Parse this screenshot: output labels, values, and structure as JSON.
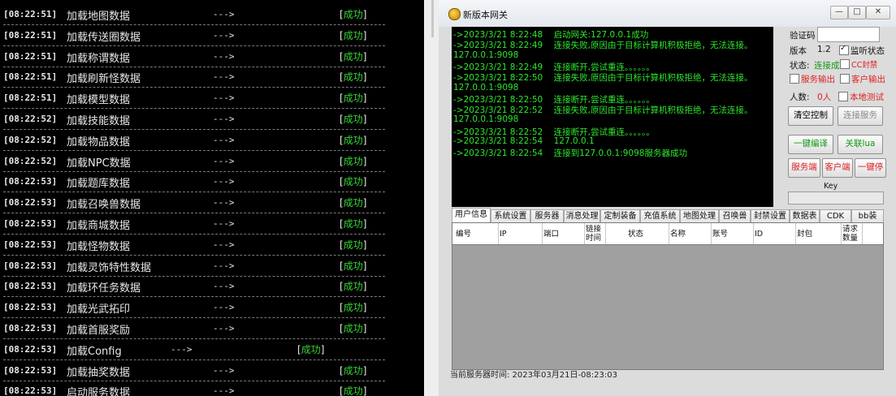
{
  "console": {
    "arrow": "--->",
    "bracket_open": "[",
    "bracket_close": "]",
    "rows": [
      {
        "time": "[08:22:51]",
        "msg": "加载地图数据",
        "status": "成功"
      },
      {
        "time": "[08:22:51]",
        "msg": "加载传送圈数据",
        "status": "成功"
      },
      {
        "time": "[08:22:51]",
        "msg": "加载称谓数据",
        "status": "成功"
      },
      {
        "time": "[08:22:51]",
        "msg": "加载刷新怪数据",
        "status": "成功"
      },
      {
        "time": "[08:22:51]",
        "msg": "加载模型数据",
        "status": "成功"
      },
      {
        "time": "[08:22:52]",
        "msg": "加载技能数据",
        "status": "成功"
      },
      {
        "time": "[08:22:52]",
        "msg": "加载物品数据",
        "status": "成功"
      },
      {
        "time": "[08:22:52]",
        "msg": "加载NPC数据",
        "status": "成功"
      },
      {
        "time": "[08:22:53]",
        "msg": "加载题库数据",
        "status": "成功"
      },
      {
        "time": "[08:22:53]",
        "msg": "加载召唤兽数据",
        "status": "成功"
      },
      {
        "time": "[08:22:53]",
        "msg": "加载商城数据",
        "status": "成功"
      },
      {
        "time": "[08:22:53]",
        "msg": "加载怪物数据",
        "status": "成功"
      },
      {
        "time": "[08:22:53]",
        "msg": "加载灵饰特性数据",
        "status": "成功"
      },
      {
        "time": "[08:22:53]",
        "msg": "加载环任务数据",
        "status": "成功"
      },
      {
        "time": "[08:22:53]",
        "msg": "加载光武拓印",
        "status": "成功"
      },
      {
        "time": "[08:22:53]",
        "msg": "加载首服奖励",
        "status": "成功"
      },
      {
        "time": "[08:22:53]",
        "msg": "加载Config",
        "status": "成功",
        "shifted": true
      },
      {
        "time": "[08:22:53]",
        "msg": "加载抽奖数据",
        "status": "成功"
      },
      {
        "time": "[08:22:53]",
        "msg": "启动服务数据",
        "status": "成功"
      }
    ]
  },
  "window": {
    "title": "新版本网关",
    "minimize": "—",
    "maximize": "□",
    "close": "✕"
  },
  "log": [
    {
      "time": "->2023/3/21 8:22:48",
      "msg": "启动网关:127.0.0.1成功",
      "cont": ""
    },
    {
      "time": "->2023/3/21 8:22:49",
      "msg": "连接失败,原因由于目标计算机积极拒绝，无法连接。",
      "cont": "127.0.0.1:9098"
    },
    {
      "time": "->2023/3/21 8:22:49",
      "msg": "连接断开,尝试重连。。。。。。",
      "cont": ""
    },
    {
      "time": "->2023/3/21 8:22:50",
      "msg": "连接失败,原因由于目标计算机积极拒绝，无法连接。",
      "cont": "127.0.0.1:9098"
    },
    {
      "time": "->2023/3/21 8:22:50",
      "msg": "连接断开,尝试重连。。。。。。",
      "cont": ""
    },
    {
      "time": "->2023/3/21 8:22:52",
      "msg": "连接失败,原因由于目标计算机积极拒绝，无法连接。",
      "cont": "127.0.0.1:9098"
    },
    {
      "time": "->2023/3/21 8:22:52",
      "msg": "连接断开,尝试重连。。。。。。",
      "cont": ""
    },
    {
      "time": "->2023/3/21 8:22:54",
      "msg": "127.0.0.1",
      "cont": ""
    },
    {
      "time": "->2023/3/21 8:22:54",
      "msg": "连接到127.0.0.1:9098服务器成功",
      "cont": ""
    }
  ],
  "panel": {
    "verify_label": "验证码",
    "verify_value": "",
    "version_label": "版本",
    "version_value": "1.2",
    "monitor_label": "监听状态",
    "status_label": "状态:",
    "status_value": "连接成功",
    "cc_label": "CC封禁",
    "server_output": "服务输出",
    "client_output": "客户输出",
    "people_label": "人数:",
    "people_value": "0人",
    "local_test": "本地测试",
    "clear_btn": "清空控制",
    "connect_btn": "连接服务",
    "compile_btn": "一键编译",
    "lua_btn": "关联lua",
    "server_btn": "服务端",
    "client_btn": "客户端",
    "stop_btn": "一键停",
    "key_label": "Key",
    "key_value": ""
  },
  "tabs": [
    "用户信息",
    "系统设置",
    "服务器",
    "消息处理",
    "定制装备",
    "充值系统",
    "地图处理",
    "召唤兽",
    "封禁设置",
    "数据表",
    "CDK",
    "bb装"
  ],
  "grid_headers": [
    "编号",
    "IP",
    "端口",
    "链接时间",
    "状态",
    "名称",
    "账号",
    "ID",
    "封包",
    "请求数量"
  ],
  "statusbar": "当前服务器时间:  2023年03月21日-08:23:03",
  "colors": {
    "console_ok": "#35d335",
    "log_text": "#2ee62e",
    "label_red": "#e02020",
    "label_green": "#119911"
  }
}
